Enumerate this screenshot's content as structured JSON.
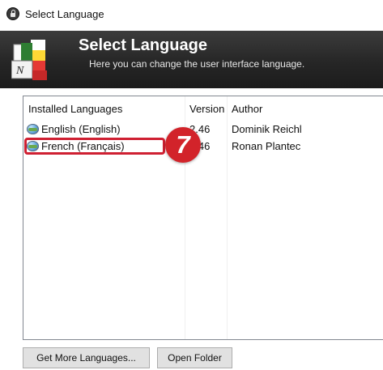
{
  "window": {
    "title": "Select Language"
  },
  "banner": {
    "title": "Select Language",
    "subtitle": "Here you can change the user interface language."
  },
  "list": {
    "columns": [
      "Installed Languages",
      "Version",
      "Author"
    ],
    "rows": [
      {
        "name": "English (English)",
        "version": "2.46",
        "author": "Dominik Reichl",
        "icon": "globe-flag-icon"
      },
      {
        "name": "French (Français)",
        "version": "2.46",
        "author": "Ronan Plantec",
        "icon": "globe-flag-icon"
      }
    ],
    "highlighted_row": 1
  },
  "annotation": {
    "step": "7",
    "color": "#d2232a"
  },
  "buttons": {
    "get_more": "Get More Languages...",
    "open_folder": "Open Folder"
  }
}
